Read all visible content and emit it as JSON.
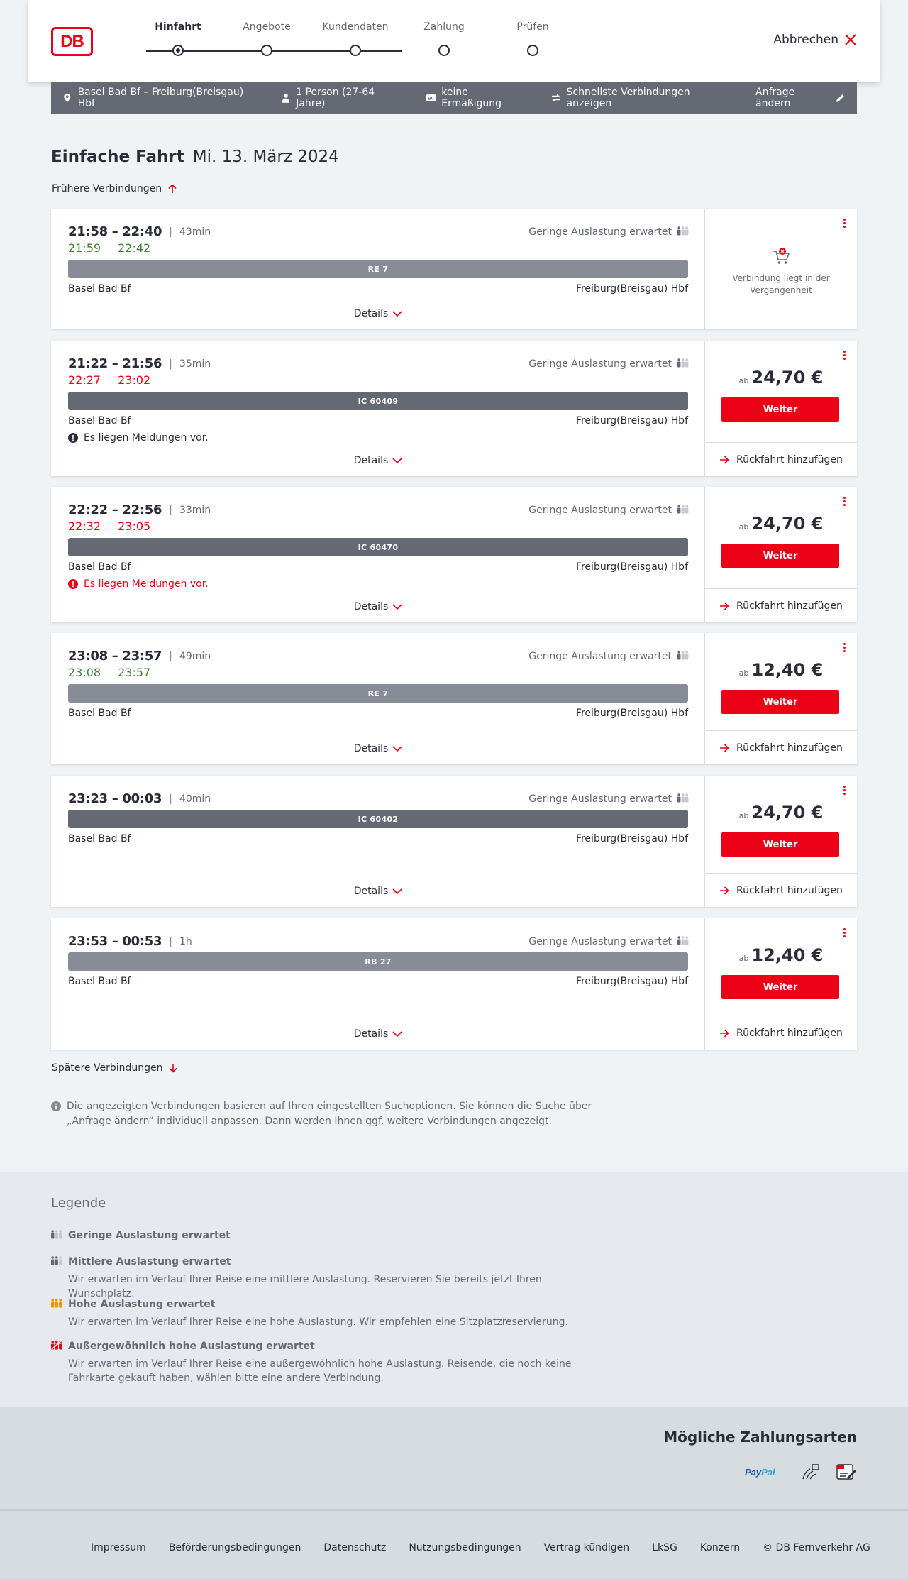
{
  "header": {
    "logo_text": "DB",
    "steps": [
      {
        "label": "Hinfahrt",
        "active": true
      },
      {
        "label": "Angebote",
        "active": false
      },
      {
        "label": "Kundendaten",
        "active": false
      },
      {
        "label": "Zahlung",
        "active": false
      },
      {
        "label": "Prüfen",
        "active": false
      }
    ],
    "cancel_label": "Abbrechen"
  },
  "search_summary": {
    "route": "Basel Bad Bf – Freiburg(Breisgau) Hbf",
    "travellers": "1 Person (27-64 Jahre)",
    "discount": "keine Ermäßigung",
    "mode": "Schnellste Verbindungen anzeigen",
    "change_label": "Anfrage ändern"
  },
  "page": {
    "title": "Einfache Fahrt",
    "date": "Mi. 13. März 2024",
    "earlier_label": "Frühere Verbindungen",
    "later_label": "Spätere Verbindungen",
    "info_text": "Die angezeigten Verbindungen basieren auf Ihren eingestellten Suchoptionen. Sie können die Suche über „Anfrage ändern“ individuell anpassen. Dann werden Ihnen ggf. weitere Verbindungen angezeigt."
  },
  "connections": [
    {
      "planned": "21:58 – 22:40",
      "duration": "43min",
      "realtime": [
        "21:59",
        "22:42"
      ],
      "realtime_status": "ok",
      "occupancy": "Geringe Auslastung erwartet",
      "train": "RE 7",
      "train_type": "re",
      "from": "Basel Bad Bf",
      "to": "Freiburg(Breisgau) Hbf",
      "message": null,
      "details_label": "Details",
      "past": true,
      "past_text": "Verbindung liegt in der Vergangenheit"
    },
    {
      "planned": "21:22 – 21:56",
      "duration": "35min",
      "realtime": [
        "22:27",
        "23:02"
      ],
      "realtime_status": "late",
      "occupancy": "Geringe Auslastung erwartet",
      "train": "IC 60409",
      "train_type": "ic",
      "from": "Basel Bad Bf",
      "to": "Freiburg(Breisgau) Hbf",
      "message": "Es liegen Meldungen vor.",
      "message_level": "info",
      "details_label": "Details",
      "price_prefix": "ab",
      "price": "24,70 €",
      "button": "Weiter",
      "return_label": "Rückfahrt hinzufügen"
    },
    {
      "planned": "22:22 – 22:56",
      "duration": "33min",
      "realtime": [
        "22:32",
        "23:05"
      ],
      "realtime_status": "late",
      "occupancy": "Geringe Auslastung erwartet",
      "train": "IC 60470",
      "train_type": "ic",
      "from": "Basel Bad Bf",
      "to": "Freiburg(Breisgau) Hbf",
      "message": "Es liegen Meldungen vor.",
      "message_level": "warn",
      "details_label": "Details",
      "price_prefix": "ab",
      "price": "24,70 €",
      "button": "Weiter",
      "return_label": "Rückfahrt hinzufügen"
    },
    {
      "planned": "23:08 – 23:57",
      "duration": "49min",
      "realtime": [
        "23:08",
        "23:57"
      ],
      "realtime_status": "ok",
      "occupancy": "Geringe Auslastung erwartet",
      "train": "RE 7",
      "train_type": "re",
      "from": "Basel Bad Bf",
      "to": "Freiburg(Breisgau) Hbf",
      "message": null,
      "details_label": "Details",
      "price_prefix": "ab",
      "price": "12,40 €",
      "button": "Weiter",
      "return_label": "Rückfahrt hinzufügen"
    },
    {
      "planned": "23:23 – 00:03",
      "duration": "40min",
      "realtime": null,
      "occupancy": "Geringe Auslastung erwartet",
      "train": "IC 60402",
      "train_type": "ic",
      "from": "Basel Bad Bf",
      "to": "Freiburg(Breisgau) Hbf",
      "message": null,
      "details_label": "Details",
      "price_prefix": "ab",
      "price": "24,70 €",
      "button": "Weiter",
      "return_label": "Rückfahrt hinzufügen"
    },
    {
      "planned": "23:53 – 00:53",
      "duration": "1h",
      "realtime": null,
      "occupancy": "Geringe Auslastung erwartet",
      "train": "RB 27",
      "train_type": "re",
      "from": "Basel Bad Bf",
      "to": "Freiburg(Breisgau) Hbf",
      "message": null,
      "details_label": "Details",
      "price_prefix": "ab",
      "price": "12,40 €",
      "button": "Weiter",
      "return_label": "Rückfahrt hinzufügen"
    }
  ],
  "legend": {
    "title": "Legende",
    "items": [
      {
        "title": "Geringe Auslastung erwartet",
        "text": "",
        "icon": "occupancy-low-icon",
        "color": "#646973"
      },
      {
        "title": "Mittlere Auslastung erwartet",
        "text": "Wir erwarten im Verlauf Ihrer Reise eine mittlere Auslastung. Reservieren Sie bereits jetzt Ihren Wunschplatz.",
        "icon": "occupancy-medium-icon",
        "color": "#646973"
      },
      {
        "title": "Hohe Auslastung erwartet",
        "text": "Wir erwarten im Verlauf Ihrer Reise eine hohe Auslastung. Wir empfehlen eine Sitzplatzreservierung.",
        "icon": "occupancy-high-icon",
        "color": "#f39200"
      },
      {
        "title": "Außergewöhnlich hohe Auslastung erwartet",
        "text": "Wir erwarten im Verlauf Ihrer Reise eine außergewöhnlich hohe Auslastung. Reisende, die noch keine Fahrkarte gekauft haben, wählen bitte eine andere Verbindung.",
        "icon": "occupancy-exceptional-icon",
        "color": "#ec0016"
      }
    ]
  },
  "payment": {
    "title": "Mögliche Zahlungsarten",
    "methods": [
      {
        "name": "PayPal",
        "icon": "paypal-icon"
      },
      {
        "name": "Lastschrift",
        "icon": "direct-debit-icon"
      },
      {
        "name": "SEPA",
        "icon": "sepa-icon"
      }
    ]
  },
  "footer": {
    "links": [
      "Impressum",
      "Beförderungsbedingungen",
      "Datenschutz",
      "Nutzungsbedingungen",
      "Vertrag kündigen",
      "LkSG",
      "Konzern"
    ],
    "copyright": "© DB Fernverkehr AG"
  },
  "colors": {
    "brand_red": "#ec0016",
    "ok_green": "#408335",
    "summary_bar": "#646973",
    "text_dark": "#282d37"
  }
}
